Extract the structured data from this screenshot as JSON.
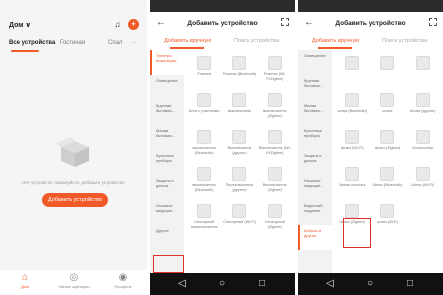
{
  "home": {
    "status_time": "",
    "status_right": "",
    "title": "Дом ∨",
    "tabs": [
      "Все устройства",
      "Гостиная",
      "Спал",
      "···"
    ],
    "empty_text": "Нет устройств, пожалуйста, добавьте устройство",
    "add_button": "Добавить устройство",
    "nav": [
      "Дом",
      "Умные сценарии",
      "Профиль"
    ]
  },
  "add": {
    "title": "Добавить устройство",
    "tab_manual": "Добавить вручную",
    "tab_auto": "Поиск устройства"
  },
  "panel2": {
    "side": [
      "Электро-инженерия",
      "Освещение",
      "Крупная бытовая...",
      "Малая бытовая...",
      "Кухонные приборы",
      "Защита и датчик",
      "Носимое медицин...",
      "Другое"
    ],
    "side_active": 0,
    "cells": [
      "Розетка",
      "Розетка (Bluetooth)",
      "Розетка (Wi-Fi/Zigbee)",
      "Блок с розетками",
      "выключатель",
      "выключатель (Zigbee)",
      "выключатель (Bluetooth)",
      "Выключатель (другое)",
      "Выключатель (Wi-Fi/Zigbee)",
      "выключатель (Bluetooth)",
      "Переключатель (другое)",
      "Выключатель (Zigbee)",
      "Сенсорный переключатель",
      "Сенсорный (Wi-Fi)",
      "Сенсорный (Zigbee)"
    ]
  },
  "panel3": {
    "side": [
      "Освещение",
      "Крупная бытовая...",
      "Малая бытовая...",
      "Кухонные приборы",
      "Защита и датчик",
      "Носимое медицин...",
      "Видеонаб-людение",
      "Шлюзы и другое"
    ],
    "side_active": 7,
    "cells": [
      "",
      "",
      "",
      "шлюз (Bluetooth)",
      "шлюз",
      "Шлюз (другое)",
      "Шлюз (Wi-Fi)",
      "Шлюз (Zigbee)",
      "Контроллер",
      "Умная колонка",
      "Шлюз (Bluetooth)",
      "Шлюз (Wi-Fi)",
      "Шлюз (Zigbee)",
      "шлюз (BLE)"
    ]
  }
}
